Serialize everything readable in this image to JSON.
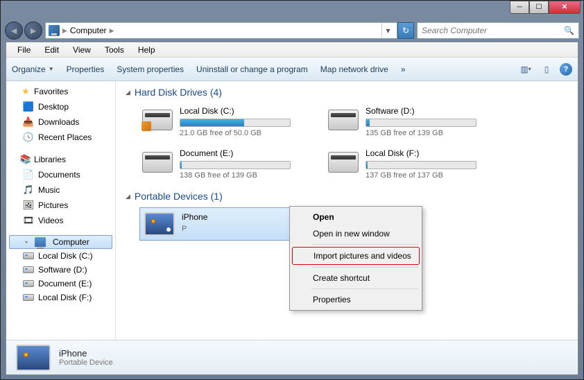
{
  "window": {
    "title": "Computer"
  },
  "address": {
    "root_icon": "computer",
    "path": "Computer",
    "search_placeholder": "Search Computer"
  },
  "menubar": [
    "File",
    "Edit",
    "View",
    "Tools",
    "Help"
  ],
  "toolbar": {
    "organize": "Organize",
    "properties": "Properties",
    "system_properties": "System properties",
    "uninstall": "Uninstall or change a program",
    "map_drive": "Map network drive",
    "more": "»"
  },
  "sidebar": {
    "favorites": {
      "label": "Favorites",
      "items": [
        "Desktop",
        "Downloads",
        "Recent Places"
      ]
    },
    "libraries": {
      "label": "Libraries",
      "items": [
        "Documents",
        "Music",
        "Pictures",
        "Videos"
      ]
    },
    "computer": {
      "label": "Computer",
      "items": [
        "Local Disk (C:)",
        "Software (D:)",
        "Document (E:)",
        "Local Disk (F:)"
      ]
    }
  },
  "main": {
    "hdd_header": "Hard Disk Drives (4)",
    "drives": [
      {
        "name": "Local Disk (C:)",
        "free": "21.0 GB free of 50.0 GB",
        "fill": 58
      },
      {
        "name": "Software (D:)",
        "free": "135 GB free of 139 GB",
        "fill": 3
      },
      {
        "name": "Document (E:)",
        "free": "138 GB free of 139 GB",
        "fill": 1
      },
      {
        "name": "Local Disk (F:)",
        "free": "137 GB free of 137 GB",
        "fill": 1
      }
    ],
    "portable_header": "Portable Devices (1)",
    "device": {
      "name": "iPhone",
      "type": "P"
    }
  },
  "context_menu": {
    "open": "Open",
    "open_new": "Open in new window",
    "import": "Import pictures and videos",
    "shortcut": "Create shortcut",
    "properties": "Properties"
  },
  "details": {
    "name": "iPhone",
    "type": "Portable Device"
  }
}
